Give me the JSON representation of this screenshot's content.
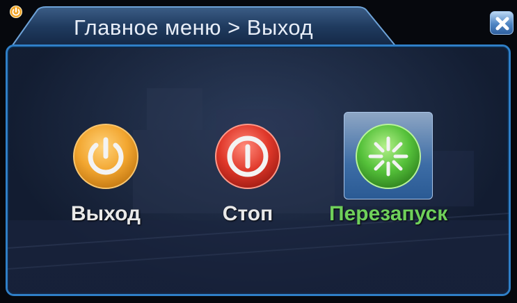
{
  "window": {
    "breadcrumb": "Главное меню > Выход",
    "close_icon": "close-icon"
  },
  "options": [
    {
      "label": "Выход",
      "icon": "power-icon",
      "color": "#f0a52a",
      "selected": false
    },
    {
      "label": "Стоп",
      "icon": "stop-icon",
      "color": "#e23b2e",
      "selected": false
    },
    {
      "label": "Перезапуск",
      "icon": "restart-icon",
      "color": "#55c13a",
      "selected": true
    }
  ],
  "colors": {
    "accent": "#2f7fc7",
    "selected_label": "#6fd05a"
  }
}
